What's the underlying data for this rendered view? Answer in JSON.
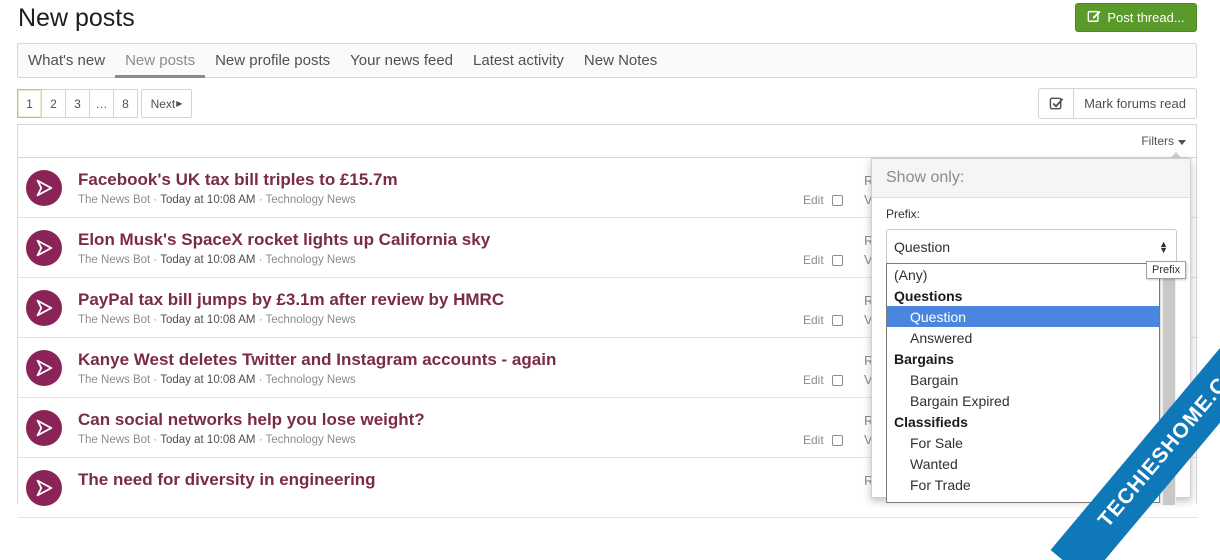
{
  "page": {
    "title": "New posts"
  },
  "actions": {
    "post_thread": "Post thread...",
    "mark_read": "Mark forums read"
  },
  "tabs": [
    {
      "label": "What's new"
    },
    {
      "label": "New posts"
    },
    {
      "label": "New profile posts"
    },
    {
      "label": "Your news feed"
    },
    {
      "label": "Latest activity"
    },
    {
      "label": "New Notes"
    }
  ],
  "pagination": {
    "pages": [
      "1",
      "2",
      "3",
      "…",
      "8"
    ],
    "next": "Next"
  },
  "filter": {
    "label": "Filters",
    "heading": "Show only:",
    "prefix_label": "Prefix:",
    "selected": "Question",
    "tooltip": "Prefix",
    "options": [
      {
        "text": "(Any)",
        "kind": "plain"
      },
      {
        "text": "Questions",
        "kind": "group"
      },
      {
        "text": "Question",
        "kind": "sub",
        "selected": true
      },
      {
        "text": "Answered",
        "kind": "sub"
      },
      {
        "text": "Bargains",
        "kind": "group"
      },
      {
        "text": "Bargain",
        "kind": "sub"
      },
      {
        "text": "Bargain Expired",
        "kind": "sub"
      },
      {
        "text": "Classifieds",
        "kind": "group"
      },
      {
        "text": "For Sale",
        "kind": "sub"
      },
      {
        "text": "Wanted",
        "kind": "sub"
      },
      {
        "text": "For Trade",
        "kind": "sub"
      }
    ]
  },
  "threads": [
    {
      "title": "Facebook's UK tax bill triples to £15.7m",
      "author": "The News Bot",
      "date": "Today at 10:08 AM",
      "forum": "Technology News",
      "edit": "Edit",
      "stat1": "R",
      "stat2": "V"
    },
    {
      "title": "Elon Musk's SpaceX rocket lights up California sky",
      "author": "The News Bot",
      "date": "Today at 10:08 AM",
      "forum": "Technology News",
      "edit": "Edit",
      "stat1": "R",
      "stat2": "V"
    },
    {
      "title": "PayPal tax bill jumps by £3.1m after review by HMRC",
      "author": "The News Bot",
      "date": "Today at 10:08 AM",
      "forum": "Technology News",
      "edit": "Edit",
      "stat1": "R",
      "stat2": "V"
    },
    {
      "title": "Kanye West deletes Twitter and Instagram accounts - again",
      "author": "The News Bot",
      "date": "Today at 10:08 AM",
      "forum": "Technology News",
      "edit": "Edit",
      "stat1": "R",
      "stat2": "V"
    },
    {
      "title": "Can social networks help you lose weight?",
      "author": "The News Bot",
      "date": "Today at 10:08 AM",
      "forum": "Technology News",
      "edit": "Edit",
      "stat1": "R",
      "stat2": "V"
    },
    {
      "title": "The need for diversity in engineering",
      "author": "",
      "date": "",
      "forum": "",
      "edit": "",
      "stat1": "R",
      "stat2": ""
    }
  ],
  "watermark": {
    "text": "TECHIESHOME.COM"
  },
  "colors": {
    "accent": "#5a9a2a",
    "thread_title": "#7a2a4a",
    "avatar": "#8a2458",
    "selection": "#4a86e0",
    "watermark": "#0e78b8"
  }
}
